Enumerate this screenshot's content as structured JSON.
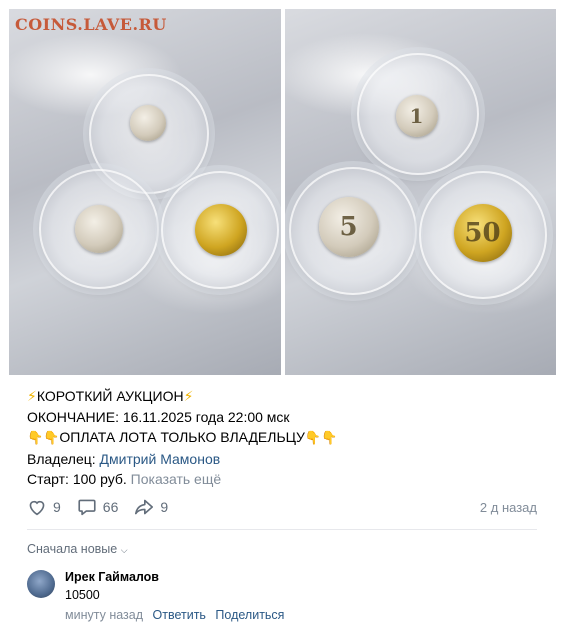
{
  "photos": {
    "watermark": "COINS.LAVE.RU",
    "left_coins": [
      "",
      "",
      ""
    ],
    "right_coins": [
      "1",
      "5",
      "50"
    ]
  },
  "post": {
    "line1": "КОРОТКИЙ АУКЦИОН",
    "line2": "ОКОНЧАНИЕ: 16.11.2025 года 22:00 мск",
    "line3": "ОПЛАТА ЛОТА ТОЛЬКО ВЛАДЕЛЬЦУ",
    "owner_label": "Владелец: ",
    "owner_name": "Дмитрий Мамонов",
    "start_text": "Старт: 100 руб.",
    "show_more": "Показать ещё"
  },
  "actions": {
    "likes": "9",
    "comments": "66",
    "shares": "9",
    "time": "2 д назад"
  },
  "comments": {
    "sort_label": "Сначала новые",
    "items": [
      {
        "author": "Ирек Гаймалов",
        "text": "10500",
        "time": "минуту назад",
        "reply": "Ответить",
        "share": "Поделиться"
      }
    ]
  },
  "colors": {
    "link": "#2a5885",
    "muted": "#818c99",
    "accent_bolt": "#f0b400"
  }
}
